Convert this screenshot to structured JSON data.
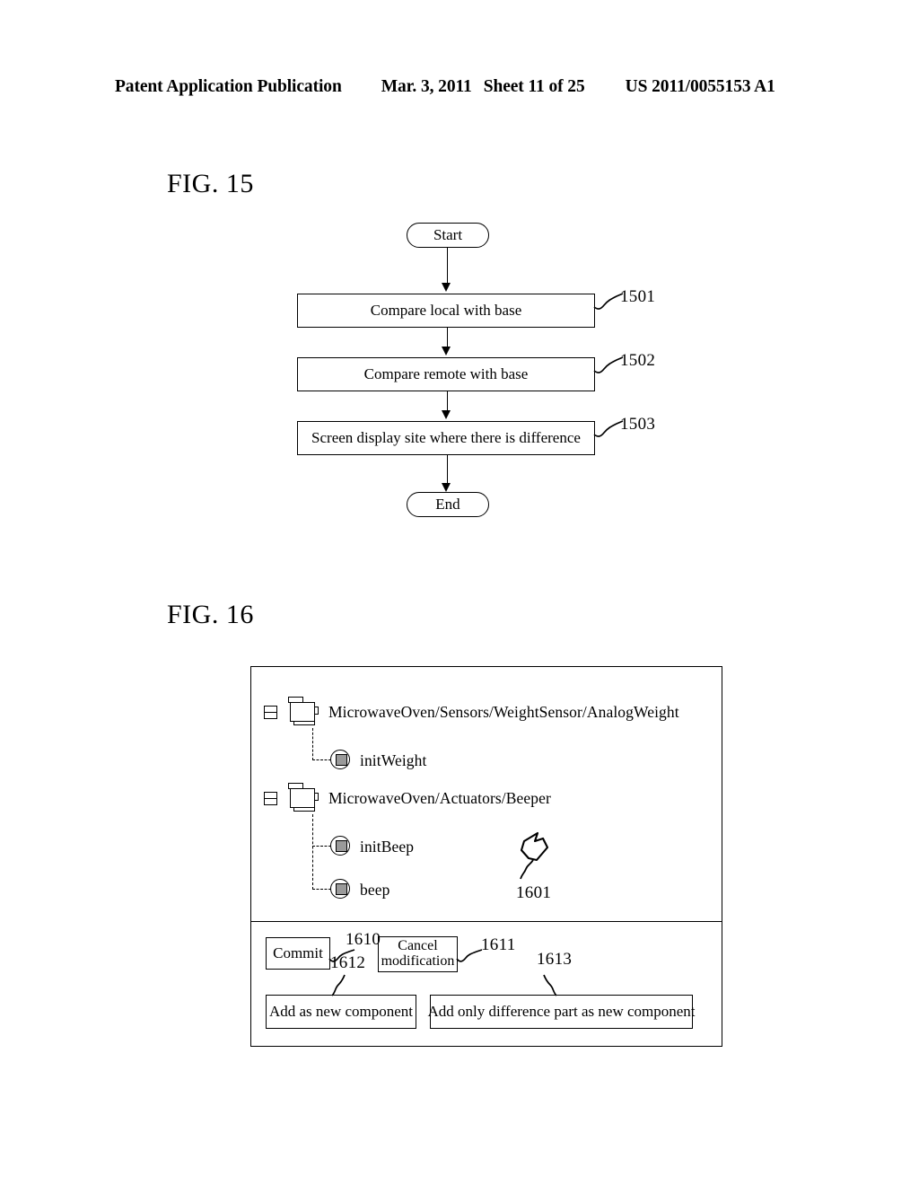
{
  "header": {
    "publication": "Patent Application Publication",
    "date": "Mar. 3, 2011",
    "sheet": "Sheet 11 of 25",
    "document_number": "US 2011/0055153 A1"
  },
  "figures": [
    {
      "id": "fig15",
      "title": "FIG. 15",
      "type": "flowchart",
      "nodes": [
        {
          "ref": "",
          "shape": "terminator",
          "label": "Start"
        },
        {
          "ref": "1501",
          "shape": "process",
          "label": "Compare local with base"
        },
        {
          "ref": "1502",
          "shape": "process",
          "label": "Compare remote with base"
        },
        {
          "ref": "1503",
          "shape": "process",
          "label": "Screen display site where there is difference"
        },
        {
          "ref": "",
          "shape": "terminator",
          "label": "End"
        }
      ]
    },
    {
      "id": "fig16",
      "title": "FIG. 16",
      "type": "ui-panel",
      "pointer_ref": "1601",
      "tree": [
        {
          "kind": "component",
          "expander": "minus",
          "label": "MicrowaveOven/Sensors/WeightSensor/AnalogWeight",
          "children": [
            {
              "kind": "method",
              "label": "initWeight"
            }
          ]
        },
        {
          "kind": "component",
          "expander": "minus",
          "label": "MicrowaveOven/Actuators/Beeper",
          "children": [
            {
              "kind": "method",
              "label": "initBeep"
            },
            {
              "kind": "method",
              "label": "beep"
            }
          ]
        }
      ],
      "buttons": [
        {
          "ref": "1610",
          "label": "Commit"
        },
        {
          "ref": "1611",
          "label": "Cancel modification"
        },
        {
          "ref": "1612",
          "label": "Add as new component"
        },
        {
          "ref": "1613",
          "label": "Add only difference part as new component"
        }
      ]
    }
  ]
}
